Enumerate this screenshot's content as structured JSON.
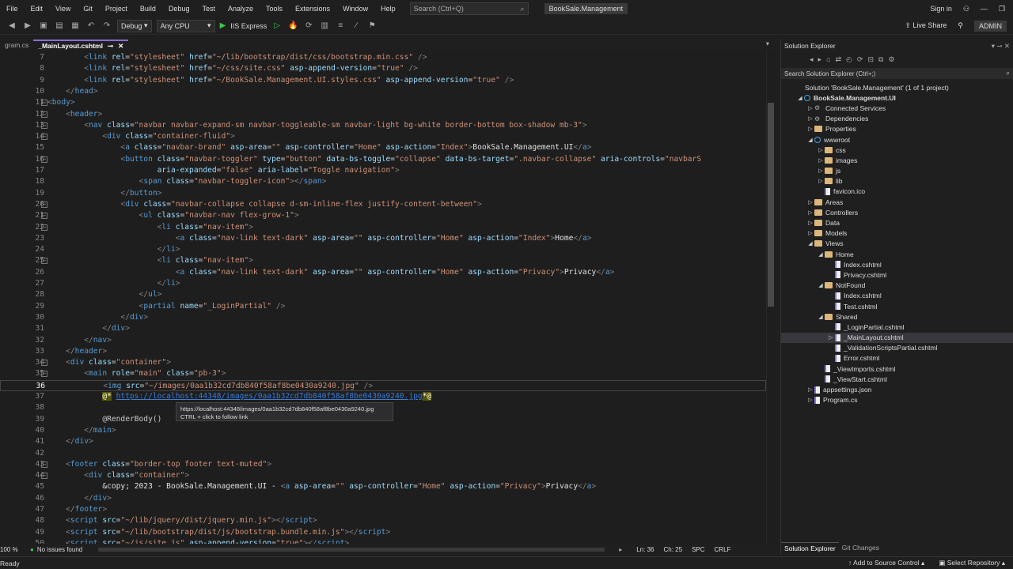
{
  "menu": [
    "File",
    "Edit",
    "View",
    "Git",
    "Project",
    "Build",
    "Debug",
    "Test",
    "Analyze",
    "Tools",
    "Extensions",
    "Window",
    "Help"
  ],
  "search_placeholder": "Search (Ctrl+Q)",
  "solution_badge": "BookSale.Management",
  "sign_in": "Sign in",
  "live_share": "Live Share",
  "admin": "ADMIN",
  "toolbar": {
    "config": "Debug",
    "platform": "Any CPU",
    "run": "IIS Express"
  },
  "tabs": [
    {
      "label": "gram.cs",
      "active": false
    },
    {
      "label": "_MainLayout.cshtml",
      "active": true
    }
  ],
  "editor": {
    "lines": [
      {
        "n": "7",
        "html": "        <span class='p'>&lt;</span><span class='t'>link</span> <span class='a'>rel</span>=<span class='s'>\"stylesheet\"</span> <span class='a'>href</span>=<span class='s'>\"~/lib/bootstrap/dist/css/bootstrap.min.css\"</span> <span class='p'>/&gt;</span>"
      },
      {
        "n": "8",
        "html": "        <span class='p'>&lt;</span><span class='t'>link</span> <span class='a'>rel</span>=<span class='s'>\"stylesheet\"</span> <span class='a'>href</span>=<span class='s'>\"~/css/site.css\"</span> <span class='a'>asp-append-version</span>=<span class='s'>\"true\"</span> <span class='p'>/&gt;</span>"
      },
      {
        "n": "9",
        "html": "        <span class='p'>&lt;</span><span class='t'>link</span> <span class='a'>rel</span>=<span class='s'>\"stylesheet\"</span> <span class='a'>href</span>=<span class='s'>\"~/BookSale.Management.UI.styles.css\"</span> <span class='a'>asp-append-version</span>=<span class='s'>\"true\"</span> <span class='p'>/&gt;</span>"
      },
      {
        "n": "10",
        "html": "    <span class='p'>&lt;/</span><span class='t'>head</span><span class='p'>&gt;</span>"
      },
      {
        "n": "11",
        "html": "<span class='p'>&lt;</span><span class='t'>body</span><span class='p'>&gt;</span>",
        "fold": "−"
      },
      {
        "n": "12",
        "html": "    <span class='p'>&lt;</span><span class='t'>header</span><span class='p'>&gt;</span>",
        "fold": "−"
      },
      {
        "n": "13",
        "html": "        <span class='p'>&lt;</span><span class='t'>nav</span> <span class='a'>class</span>=<span class='s'>\"navbar navbar-expand-sm navbar-toggleable-sm navbar-light bg-white border-bottom box-shadow mb-3\"</span><span class='p'>&gt;</span>",
        "fold": "−"
      },
      {
        "n": "14",
        "html": "            <span class='p'>&lt;</span><span class='t'>div</span> <span class='a'>class</span>=<span class='s'>\"container-fluid\"</span><span class='p'>&gt;</span>",
        "fold": "−"
      },
      {
        "n": "15",
        "html": "                <span class='p'>&lt;</span><span class='t'>a</span> <span class='a'>class</span>=<span class='s'>\"navbar-brand\"</span> <span class='a'>asp-area</span>=<span class='s'>\"\"</span> <span class='a'>asp-controller</span>=<span class='s'>\"Home\"</span> <span class='a'>asp-action</span>=<span class='s'>\"Index\"</span><span class='p'>&gt;</span><span class='k'>BookSale.Management.UI</span><span class='p'>&lt;/</span><span class='t'>a</span><span class='p'>&gt;</span>"
      },
      {
        "n": "16",
        "html": "                <span class='p'>&lt;</span><span class='t'>button</span> <span class='a'>class</span>=<span class='s'>\"navbar-toggler\"</span> <span class='a'>type</span>=<span class='s'>\"button\"</span> <span class='a'>data-bs-toggle</span>=<span class='s'>\"collapse\"</span> <span class='a'>data-bs-target</span>=<span class='s'>\".navbar-collapse\"</span> <span class='a'>aria-controls</span>=<span class='s'>\"navbarS</span>",
        "fold": "−"
      },
      {
        "n": "17",
        "html": "                        <span class='a'>aria-expanded</span>=<span class='s'>\"false\"</span> <span class='a'>aria-label</span>=<span class='s'>\"Toggle navigation\"</span><span class='p'>&gt;</span>"
      },
      {
        "n": "18",
        "html": "                    <span class='p'>&lt;</span><span class='t'>span</span> <span class='a'>class</span>=<span class='s'>\"navbar-toggler-icon\"</span><span class='p'>&gt;&lt;/</span><span class='t'>span</span><span class='p'>&gt;</span>"
      },
      {
        "n": "19",
        "html": "                <span class='p'>&lt;/</span><span class='t'>button</span><span class='p'>&gt;</span>"
      },
      {
        "n": "20",
        "html": "                <span class='p'>&lt;</span><span class='t'>div</span> <span class='a'>class</span>=<span class='s'>\"navbar-collapse collapse d-sm-inline-flex justify-content-between\"</span><span class='p'>&gt;</span>",
        "fold": "−"
      },
      {
        "n": "21",
        "html": "                    <span class='p'>&lt;</span><span class='t'>ul</span> <span class='a'>class</span>=<span class='s'>\"navbar-nav flex-grow-1\"</span><span class='p'>&gt;</span>",
        "fold": "−"
      },
      {
        "n": "22",
        "html": "                        <span class='p'>&lt;</span><span class='t'>li</span> <span class='a'>class</span>=<span class='s'>\"nav-item\"</span><span class='p'>&gt;</span>",
        "fold": "−"
      },
      {
        "n": "23",
        "html": "                            <span class='p'>&lt;</span><span class='t'>a</span> <span class='a'>class</span>=<span class='s'>\"nav-link text-dark\"</span> <span class='a'>asp-area</span>=<span class='s'>\"\"</span> <span class='a'>asp-controller</span>=<span class='s'>\"Home\"</span> <span class='a'>asp-action</span>=<span class='s'>\"Index\"</span><span class='p'>&gt;</span><span class='k'>Home</span><span class='p'>&lt;/</span><span class='t'>a</span><span class='p'>&gt;</span>"
      },
      {
        "n": "24",
        "html": "                        <span class='p'>&lt;/</span><span class='t'>li</span><span class='p'>&gt;</span>"
      },
      {
        "n": "25",
        "html": "                        <span class='p'>&lt;</span><span class='t'>li</span> <span class='a'>class</span>=<span class='s'>\"nav-item\"</span><span class='p'>&gt;</span>",
        "fold": "−"
      },
      {
        "n": "26",
        "html": "                            <span class='p'>&lt;</span><span class='t'>a</span> <span class='a'>class</span>=<span class='s'>\"nav-link text-dark\"</span> <span class='a'>asp-area</span>=<span class='s'>\"\"</span> <span class='a'>asp-controller</span>=<span class='s'>\"Home\"</span> <span class='a'>asp-action</span>=<span class='s'>\"Privacy\"</span><span class='p'>&gt;</span><span class='k'>Privacy</span><span class='p'>&lt;/</span><span class='t'>a</span><span class='p'>&gt;</span>"
      },
      {
        "n": "27",
        "html": "                        <span class='p'>&lt;/</span><span class='t'>li</span><span class='p'>&gt;</span>"
      },
      {
        "n": "28",
        "html": "                    <span class='p'>&lt;/</span><span class='t'>ul</span><span class='p'>&gt;</span>"
      },
      {
        "n": "29",
        "html": "                    <span class='p'>&lt;</span><span class='t'>partial</span> <span class='a'>name</span>=<span class='s'>\"_LoginPartial\"</span> <span class='p'>/&gt;</span>"
      },
      {
        "n": "30",
        "html": "                <span class='p'>&lt;/</span><span class='t'>div</span><span class='p'>&gt;</span>"
      },
      {
        "n": "31",
        "html": "            <span class='p'>&lt;/</span><span class='t'>div</span><span class='p'>&gt;</span>"
      },
      {
        "n": "32",
        "html": "        <span class='p'>&lt;/</span><span class='t'>nav</span><span class='p'>&gt;</span>"
      },
      {
        "n": "33",
        "html": "    <span class='p'>&lt;/</span><span class='t'>header</span><span class='p'>&gt;</span>"
      },
      {
        "n": "34",
        "html": "    <span class='p'>&lt;</span><span class='t'>div</span> <span class='a'>class</span>=<span class='s'>\"container\"</span><span class='p'>&gt;</span>",
        "fold": "−"
      },
      {
        "n": "35",
        "html": "        <span class='p'>&lt;</span><span class='t'>main</span> <span class='a'>role</span>=<span class='s'>\"main\"</span> <span class='a'>class</span>=<span class='s'>\"pb-3\"</span><span class='p'>&gt;</span>",
        "fold": "−"
      },
      {
        "n": "36",
        "html": "            <span class='p'>&lt;</span><span class='t'>img</span> <span class='a'>src</span>=<span class='s'>\"~/images/0aa1b32cd7db840f58af8be0430a9240.jpg\"</span> <span class='p'>/&gt;</span>",
        "current": true
      },
      {
        "n": "37",
        "html": "            <span class='at'>@*</span> <span class='link'>https://localhost:44348/images/0aa1b32cd7db840f58af8be0430a9240.jpg</span><span class='at'>*@</span>"
      },
      {
        "n": "38",
        "html": ""
      },
      {
        "n": "39",
        "html": "            <span class='razor'>@RenderBody()</span>"
      },
      {
        "n": "40",
        "html": "        <span class='p'>&lt;/</span><span class='t'>main</span><span class='p'>&gt;</span>"
      },
      {
        "n": "41",
        "html": "    <span class='p'>&lt;/</span><span class='t'>div</span><span class='p'>&gt;</span>"
      },
      {
        "n": "42",
        "html": ""
      },
      {
        "n": "43",
        "html": "    <span class='p'>&lt;</span><span class='t'>footer</span> <span class='a'>class</span>=<span class='s'>\"border-top footer text-muted\"</span><span class='p'>&gt;</span>",
        "fold": "−"
      },
      {
        "n": "44",
        "html": "        <span class='p'>&lt;</span><span class='t'>div</span> <span class='a'>class</span>=<span class='s'>\"container\"</span><span class='p'>&gt;</span>",
        "fold": "−"
      },
      {
        "n": "45",
        "html": "            <span class='k'>&amp;copy; 2023 - BookSale.Management.UI - </span><span class='p'>&lt;</span><span class='t'>a</span> <span class='a'>asp-area</span>=<span class='s'>\"\"</span> <span class='a'>asp-controller</span>=<span class='s'>\"Home\"</span> <span class='a'>asp-action</span>=<span class='s'>\"Privacy\"</span><span class='p'>&gt;</span><span class='k'>Privacy</span><span class='p'>&lt;/</span><span class='t'>a</span><span class='p'>&gt;</span>"
      },
      {
        "n": "46",
        "html": "        <span class='p'>&lt;/</span><span class='t'>div</span><span class='p'>&gt;</span>"
      },
      {
        "n": "47",
        "html": "    <span class='p'>&lt;/</span><span class='t'>footer</span><span class='p'>&gt;</span>"
      },
      {
        "n": "48",
        "html": "    <span class='p'>&lt;</span><span class='t'>script</span> <span class='a'>src</span>=<span class='s'>\"~/lib/jquery/dist/jquery.min.js\"</span><span class='p'>&gt;&lt;/</span><span class='t'>script</span><span class='p'>&gt;</span>"
      },
      {
        "n": "49",
        "html": "    <span class='p'>&lt;</span><span class='t'>script</span> <span class='a'>src</span>=<span class='s'>\"~/lib/bootstrap/dist/js/bootstrap.bundle.min.js\"</span><span class='p'>&gt;&lt;/</span><span class='t'>script</span><span class='p'>&gt;</span>"
      },
      {
        "n": "50",
        "html": "    <span class='p'>&lt;</span><span class='t'>script</span> <span class='a'>src</span>=<span class='s'>\"~/js/site.js\"</span> <span class='a'>asp-append-version</span>=<span class='s'>\"true\"</span><span class='p'>&gt;&lt;/</span><span class='t'>script</span><span class='p'>&gt;</span>"
      }
    ],
    "tooltip_line1": "https://localhost:44348/images/0aa1b32cd7db840f58af8be0430a9240.jpg",
    "tooltip_line2": "CTRL + click to follow link",
    "zoom": "100 %",
    "issues": "No issues found",
    "position": "Ln: 36",
    "col": "Ch: 25",
    "spc": "SPC",
    "crlf": "CRLF"
  },
  "solution_explorer": {
    "title": "Solution Explorer",
    "search": "Search Solution Explorer (Ctrl+;)",
    "nodes": [
      {
        "label": "Solution 'BookSale.Management' (1 of 1 project)",
        "indent": 0,
        "type": "sol"
      },
      {
        "label": "BookSale.Management.UI",
        "indent": 1,
        "arrow": "◢",
        "type": "globe",
        "bold": true
      },
      {
        "label": "Connected Services",
        "indent": 2,
        "arrow": "▷",
        "type": "gear"
      },
      {
        "label": "Dependencies",
        "indent": 2,
        "arrow": "▷",
        "type": "gear"
      },
      {
        "label": "Properties",
        "indent": 2,
        "arrow": "▷",
        "type": "folder"
      },
      {
        "label": "wwwroot",
        "indent": 2,
        "arrow": "◢",
        "type": "globe"
      },
      {
        "label": "css",
        "indent": 3,
        "arrow": "▷",
        "type": "folder"
      },
      {
        "label": "images",
        "indent": 3,
        "arrow": "▷",
        "type": "folder"
      },
      {
        "label": "js",
        "indent": 3,
        "arrow": "▷",
        "type": "folder"
      },
      {
        "label": "lib",
        "indent": 3,
        "arrow": "▷",
        "type": "folder"
      },
      {
        "label": "favicon.ico",
        "indent": 3,
        "type": "file"
      },
      {
        "label": "Areas",
        "indent": 2,
        "arrow": "▷",
        "type": "folder"
      },
      {
        "label": "Controllers",
        "indent": 2,
        "arrow": "▷",
        "type": "folder"
      },
      {
        "label": "Data",
        "indent": 2,
        "arrow": "▷",
        "type": "folder"
      },
      {
        "label": "Models",
        "indent": 2,
        "arrow": "▷",
        "type": "folder"
      },
      {
        "label": "Views",
        "indent": 2,
        "arrow": "◢",
        "type": "folder"
      },
      {
        "label": "Home",
        "indent": 3,
        "arrow": "◢",
        "type": "folder"
      },
      {
        "label": "Index.cshtml",
        "indent": 4,
        "type": "file"
      },
      {
        "label": "Privacy.cshtml",
        "indent": 4,
        "type": "file"
      },
      {
        "label": "NotFound",
        "indent": 3,
        "arrow": "◢",
        "type": "folder"
      },
      {
        "label": "Index.cshtml",
        "indent": 4,
        "type": "file"
      },
      {
        "label": "Test.cshtml",
        "indent": 4,
        "type": "file"
      },
      {
        "label": "Shared",
        "indent": 3,
        "arrow": "◢",
        "type": "folder"
      },
      {
        "label": "_LoginPartial.cshtml",
        "indent": 4,
        "type": "file"
      },
      {
        "label": "_MainLayout.cshtml",
        "indent": 4,
        "arrow": "▷",
        "type": "file",
        "selected": true
      },
      {
        "label": "_ValidationScriptsPartial.cshtml",
        "indent": 4,
        "type": "file"
      },
      {
        "label": "Error.cshtml",
        "indent": 4,
        "type": "file"
      },
      {
        "label": "_ViewImports.cshtml",
        "indent": 3,
        "type": "file"
      },
      {
        "label": "_ViewStart.cshtml",
        "indent": 3,
        "type": "file"
      },
      {
        "label": "appsettings.json",
        "indent": 2,
        "arrow": "▷",
        "type": "file"
      },
      {
        "label": "Program.cs",
        "indent": 2,
        "arrow": "▷",
        "type": "file"
      }
    ],
    "bottom_tabs": [
      "Solution Explorer",
      "Git Changes"
    ]
  },
  "status": {
    "left": "Ready",
    "add_source": "Add to Source Control",
    "select_repo": "Select Repository"
  }
}
